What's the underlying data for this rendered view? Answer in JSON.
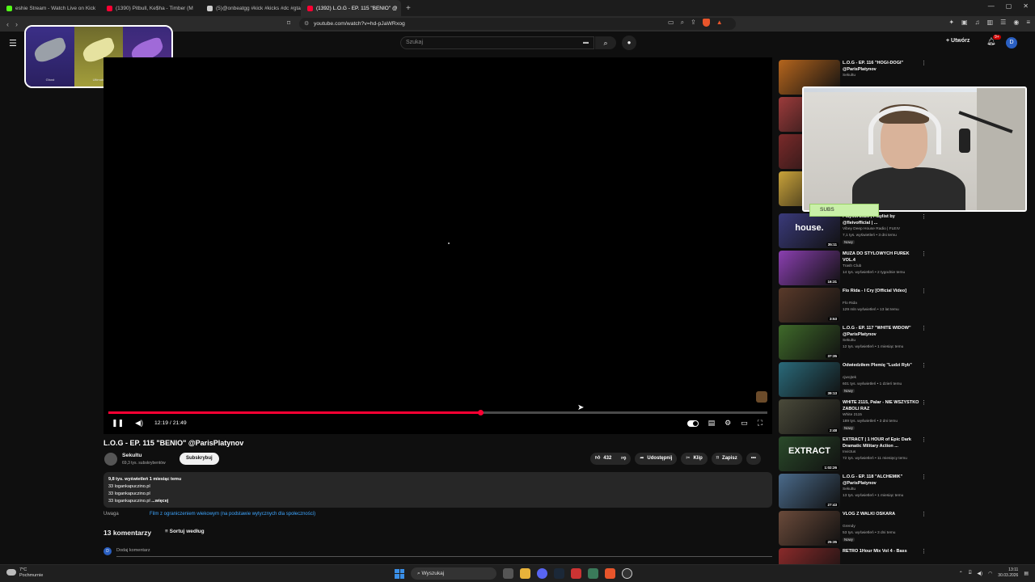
{
  "browser": {
    "tabs": [
      {
        "label": "eshie Stream - Watch Live on Kick",
        "color": "#53fc18"
      },
      {
        "label": "(1390) Pitbull, Ke$ha - Timber (M",
        "color": "#ff0033"
      },
      {
        "label": "(5)@onbeatgg #kick #kicks #dc #gta",
        "color": "#cccccc"
      },
      {
        "label": "(1392) L.O.G - EP. 115 \"BENIO\" @",
        "color": "#ff0033"
      }
    ],
    "url": "youtube.com/watch?v=hd-pJaWRxog"
  },
  "youtube": {
    "search_placeholder": "Szukaj",
    "create_label": "Utwórz",
    "bell_badge": "9+",
    "avatar_letter": "D"
  },
  "overlay_card": {
    "items": [
      "Ghost",
      "Ultimate",
      "Desert Eagle"
    ]
  },
  "player": {
    "time": "12:19 / 21:49",
    "progress": 0.564
  },
  "video": {
    "title": "L.O.G - EP. 115 \"BENIO\" @ParisPlatynov",
    "channel": "Sekultu",
    "subscribers": "69,3 tys. subskrybentów",
    "subscribe_label": "Subskrybuj",
    "likes": "432",
    "share_label": "Udostępnij",
    "clip_label": "Klip",
    "save_label": "Zapisz",
    "description": {
      "stats": "9,8 tys. wyświetleń  1 miesiąc temu",
      "lines": [
        "33 logankapuczino.pl",
        "33 logankapuczino.pl",
        "33 logankapuczino.pl"
      ],
      "more_label": "...więcej"
    },
    "warning_label": "Uwaga",
    "warning_text": "Film z ograniczeniem wiekowym (na podstawie wytycznych dla społeczności)",
    "comments_count": "13 komentarzy",
    "sort_label": "Sortuj według",
    "add_comment": "Dodaj komentarz",
    "commenter_letter": "D"
  },
  "sidebar": [
    {
      "title": "L.O.G - EP. 116 \"HOGI-DOGI\" @ParisPlatynov",
      "channel": "Sekultu",
      "meta": "",
      "duration": "",
      "badge": "",
      "color": "#b5651d"
    },
    {
      "title": "",
      "channel": "",
      "meta": "",
      "duration": "",
      "badge": "",
      "color": "#9c3b3b"
    },
    {
      "title": "",
      "channel": "",
      "meta": "",
      "duration": "",
      "badge": "",
      "color": "#7a2a2a"
    },
    {
      "title": "",
      "channel": "",
      "meta": "",
      "duration": "",
      "badge": "",
      "color": "#c9a23a"
    },
    {
      "title": "Playlist 2026 | Playlist by @fleivofficial | ...",
      "channel": "Vibey Deep House Radio | FLEIV",
      "meta": "7,1 tys. wyświetleń • 3 dni temu",
      "duration": "35:11",
      "badge": "Nowy",
      "color": "#3a3a7a",
      "thumb_text": "house."
    },
    {
      "title": "MUZA DO STYLOWYCH FUREK VOL.4",
      "channel": "Trash Club",
      "meta": "14 tys. wyświetleń • 2 tygodnie temu",
      "duration": "16:31",
      "badge": "",
      "color": "#8a3fb0"
    },
    {
      "title": "Flo Rida - I Cry [Official Video]",
      "channel": "Flo Rida",
      "meta": "129 mln wyświetleń • 13 lat temu",
      "duration": "3:53",
      "badge": "",
      "color": "#5a3a2a"
    },
    {
      "title": "L.O.G - EP. 117 \"WHITE WIDOW\" @ParisPlatynov",
      "channel": "Sekultu",
      "meta": "12 tys. wyświetleń • 1 miesiąc temu",
      "duration": "37:35",
      "badge": "",
      "color": "#3f6a2a"
    },
    {
      "title": "Odwiedziłem Plemię \"Ludzi Ryb\"",
      "channel": "cjwojtek",
      "meta": "601 tys. wyświetleń • 1 dzień temu",
      "duration": "39:13",
      "badge": "Nowy",
      "color": "#2a6a7a"
    },
    {
      "title": "WHITE 2115, Palar - NIE WSZYSTKO ZABOLI RAZ",
      "channel": "White 2115",
      "meta": "189 tys. wyświetleń • 3 dni temu",
      "duration": "2:48",
      "badge": "Nowy",
      "color": "#4a4a3a"
    },
    {
      "title": "EXTRACT | 1 HOUR of Epic Dark Dramatic Military Action ...",
      "channel": "Invictus",
      "meta": "72 tys. wyświetleń • 11 miesięcy temu",
      "duration": "1:02:26",
      "badge": "",
      "color": "#2a4a2a",
      "thumb_text": "EXTRACT"
    },
    {
      "title": "L.O.G - EP. 118 \"ALCHEMIK\" @ParisPlatynov",
      "channel": "Sekultu",
      "meta": "13 tys. wyświetleń • 1 miesiąc temu",
      "duration": "27:43",
      "badge": "",
      "color": "#4a6a8a"
    },
    {
      "title": "VLOG Z WALKI OSKARA",
      "channel": "Grendy",
      "meta": "53 tys. wyświetleń • 3 dni temu",
      "duration": "25:35",
      "badge": "Nowy",
      "color": "#6a4a3a"
    },
    {
      "title": "RETRO 1Hour Mix Vol 4 - Bass",
      "channel": "",
      "meta": "",
      "duration": "",
      "badge": "",
      "color": "#8a2a2a"
    }
  ],
  "cam": {
    "subs_label": "SUBS"
  },
  "taskbar": {
    "temp": "7°C",
    "weather": "Pochmurnie",
    "search_label": "Wyszukaj",
    "time": "13:11",
    "date": "30.03.2026"
  }
}
